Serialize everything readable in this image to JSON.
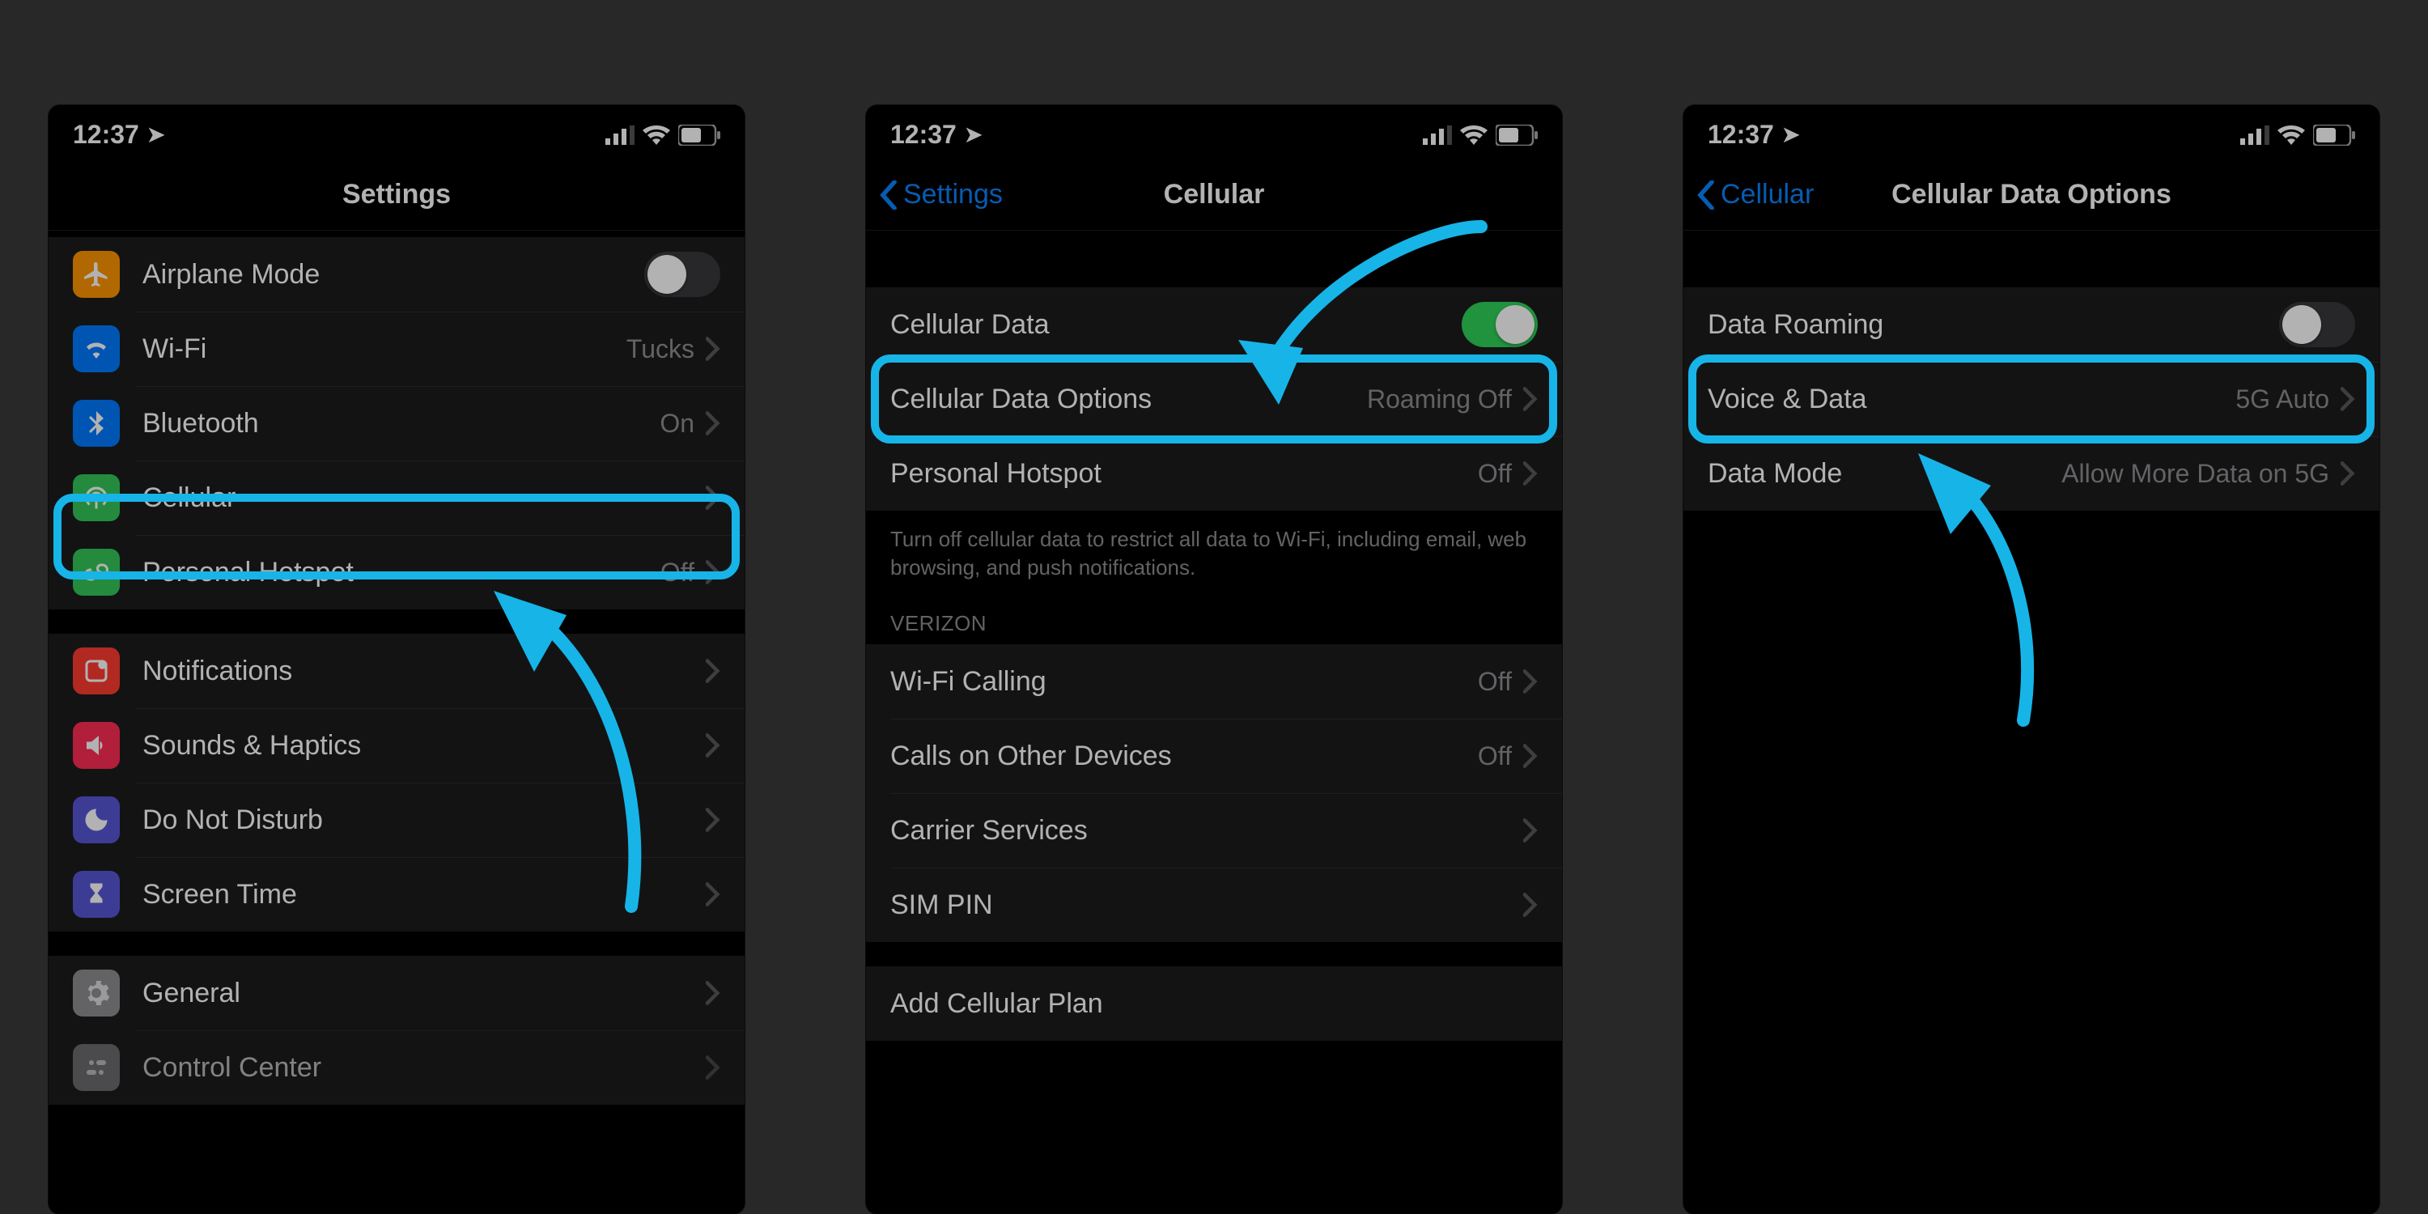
{
  "status": {
    "time": "12:37",
    "location_glyph": "➤"
  },
  "screen1": {
    "title": "Settings",
    "group1": [
      {
        "label": "Airplane Mode",
        "kind": "toggle",
        "on": false
      },
      {
        "label": "Wi-Fi",
        "value": "Tucks"
      },
      {
        "label": "Bluetooth",
        "value": "On"
      },
      {
        "label": "Cellular"
      },
      {
        "label": "Personal Hotspot",
        "value": "Off"
      }
    ],
    "group2": [
      {
        "label": "Notifications"
      },
      {
        "label": "Sounds & Haptics"
      },
      {
        "label": "Do Not Disturb"
      },
      {
        "label": "Screen Time"
      }
    ],
    "group3": [
      {
        "label": "General"
      },
      {
        "label": "Control Center"
      }
    ]
  },
  "screen2": {
    "back": "Settings",
    "title": "Cellular",
    "group1": [
      {
        "label": "Cellular Data",
        "kind": "toggle",
        "on": true
      },
      {
        "label": "Cellular Data Options",
        "value": "Roaming Off"
      },
      {
        "label": "Personal Hotspot",
        "value": "Off"
      }
    ],
    "footer1": "Turn off cellular data to restrict all data to Wi-Fi, including email, web browsing, and push notifications.",
    "header2": "VERIZON",
    "group2": [
      {
        "label": "Wi-Fi Calling",
        "value": "Off"
      },
      {
        "label": "Calls on Other Devices",
        "value": "Off"
      },
      {
        "label": "Carrier Services"
      },
      {
        "label": "SIM PIN"
      }
    ],
    "link": "Add Cellular Plan"
  },
  "screen3": {
    "back": "Cellular",
    "title": "Cellular Data Options",
    "group1": [
      {
        "label": "Data Roaming",
        "kind": "toggle",
        "on": false
      },
      {
        "label": "Voice & Data",
        "value": "5G Auto"
      },
      {
        "label": "Data Mode",
        "value": "Allow More Data on 5G"
      }
    ]
  }
}
